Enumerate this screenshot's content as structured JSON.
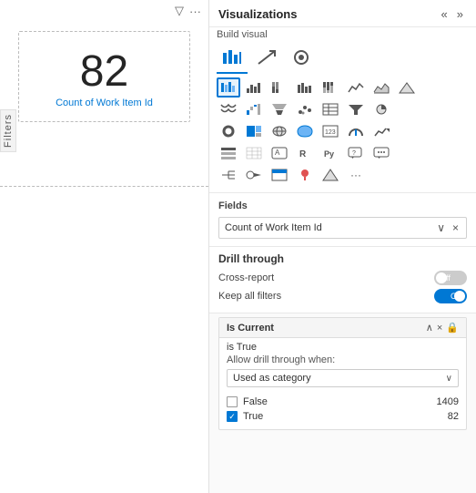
{
  "leftPanel": {
    "cardNumber": "82",
    "cardLabel": "Count of Work Item Id",
    "filtersLabel": "Filters"
  },
  "rightPanel": {
    "title": "Visualizations",
    "navLeft": "«",
    "navRight": "»",
    "buildVisual": "Build visual",
    "chartTabs": [
      {
        "label": "⊞",
        "active": true
      },
      {
        "label": "↕"
      },
      {
        "label": "◎"
      }
    ],
    "iconRows": [
      [
        "▦",
        "▤",
        "▥",
        "▧",
        "▣",
        "▩",
        "∿",
        "▲"
      ],
      [
        "≋",
        "▦",
        "▤",
        "▧",
        "⊞",
        "◉",
        "⊡"
      ],
      [
        "◔",
        "⊟",
        "❋",
        "⌘",
        "123",
        "▲",
        "△▽"
      ],
      [
        "⊠",
        "⊞",
        "⊡",
        "R",
        "Py",
        "⊞",
        "💬"
      ],
      [
        "⊟",
        "⊕",
        "⊡",
        "📍",
        "◇",
        "≫",
        "···"
      ]
    ],
    "fieldsSection": {
      "label": "Fields",
      "fieldPill": {
        "text": "Count of Work Item Id",
        "expandIcon": "∨",
        "closeIcon": "×"
      }
    },
    "drillthroughSection": {
      "title": "Drill through",
      "crossReport": {
        "label": "Cross-report",
        "state": "off",
        "stateLabel": "Off"
      },
      "keepAllFilters": {
        "label": "Keep all filters",
        "state": "on",
        "stateLabel": "On"
      }
    },
    "isCurrentBox": {
      "title": "Is Current",
      "chevronUp": "∧",
      "closeIcon": "×",
      "lockIcon": "🔒",
      "isTrueText": "is True",
      "allowDrillText": "Allow drill through when:",
      "dropdown": {
        "value": "Used as category",
        "arrow": "∨"
      },
      "filterItems": [
        {
          "label": "False",
          "count": "1409",
          "checked": false
        },
        {
          "label": "True",
          "count": "82",
          "checked": true
        }
      ]
    }
  }
}
